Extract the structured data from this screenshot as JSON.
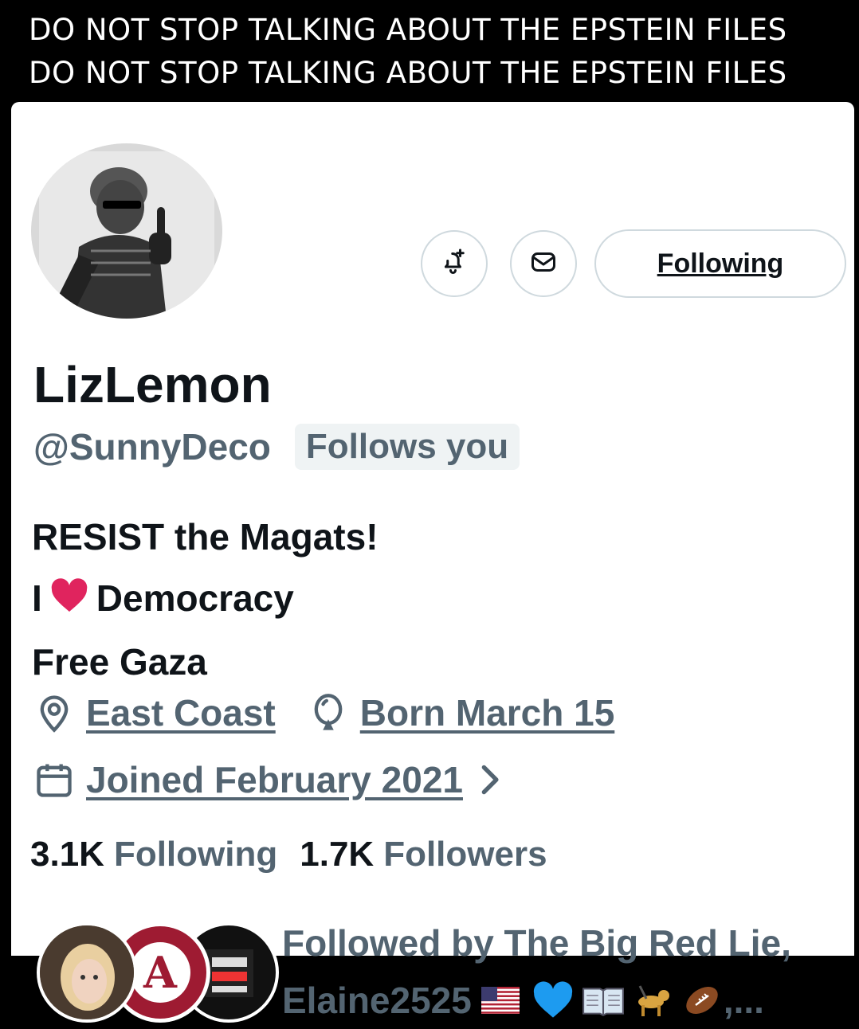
{
  "banner": {
    "line1": "DO NOT STOP TALKING ABOUT THE EPSTEIN FILES",
    "line2": "DO NOT STOP TALKING ABOUT THE EPSTEIN FILES"
  },
  "actions": {
    "notify_icon": "bell-plus-icon",
    "message_icon": "envelope-icon",
    "following_label": "Following"
  },
  "profile": {
    "name": "LizLemon",
    "handle": "@SunnyDeco",
    "follows_you": "Follows you",
    "bio": [
      "RESIST the Magats!",
      "I",
      "Democracy",
      "Free Gaza"
    ],
    "location": "East Coast",
    "birthday": "Born March 15",
    "joined": "Joined February 2021",
    "following_count": "3.1K",
    "following_label": "Following",
    "followers_count": "1.7K",
    "followers_label": "Followers",
    "followed_by_line1": "Followed by The Big Red Lie,",
    "followed_by_line2": "Elaine2525",
    "followed_by_suffix": ",..."
  },
  "colors": {
    "text_primary": "#0f1419",
    "text_secondary": "#536471",
    "border": "#cfd9de",
    "badge_bg": "#eff3f4",
    "heart": "#e0245e"
  }
}
